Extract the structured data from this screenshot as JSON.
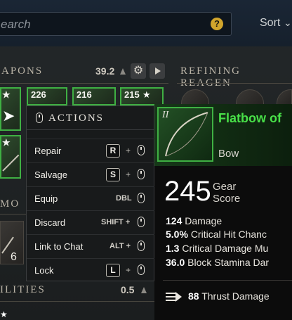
{
  "search": {
    "placeholder": "earch"
  },
  "sort": {
    "label": "Sort"
  },
  "weapons_section": {
    "title": "APONS",
    "weight": "39.2"
  },
  "refining_section": {
    "title": "REFINING REAGEN"
  },
  "ammo_section": {
    "title": "MO"
  },
  "utilities_section": {
    "title": "ILITIES",
    "weight": "0.5"
  },
  "slots": [
    {
      "gs": "226"
    },
    {
      "gs": "216"
    },
    {
      "gs": "215"
    }
  ],
  "left_slot_count": "6",
  "actions_menu": {
    "title": "ACTIONS",
    "items": [
      {
        "label": "Repair",
        "key": "R",
        "mouse": true
      },
      {
        "label": "Salvage",
        "key": "S",
        "mouse": true
      },
      {
        "label": "Equip",
        "key_text": "DBL",
        "mouse": true
      },
      {
        "label": "Discard",
        "key_text": "SHIFT +",
        "mouse": true
      },
      {
        "label": "Link to Chat",
        "key_text": "ALT +",
        "mouse": true
      },
      {
        "label": "Lock",
        "key": "L",
        "mouse": true
      }
    ]
  },
  "tooltip": {
    "tier": "II",
    "name": "Flatbow of",
    "type": "Bow",
    "gear_score": "245",
    "gear_label_1": "Gear",
    "gear_label_2": "Score",
    "stats": [
      {
        "value": "124",
        "label": "Damage"
      },
      {
        "value": "5.0%",
        "label": "Critical Hit Chanc"
      },
      {
        "value": "1.3",
        "label": "Critical Damage Mu"
      },
      {
        "value": "36.0",
        "label": "Block Stamina Dar"
      }
    ],
    "perk": {
      "value": "88",
      "label": "Thrust Damage"
    }
  },
  "colors": {
    "rarity_green": "#3fb043",
    "name_green": "#48e048",
    "help_gold": "#d1a52c"
  }
}
